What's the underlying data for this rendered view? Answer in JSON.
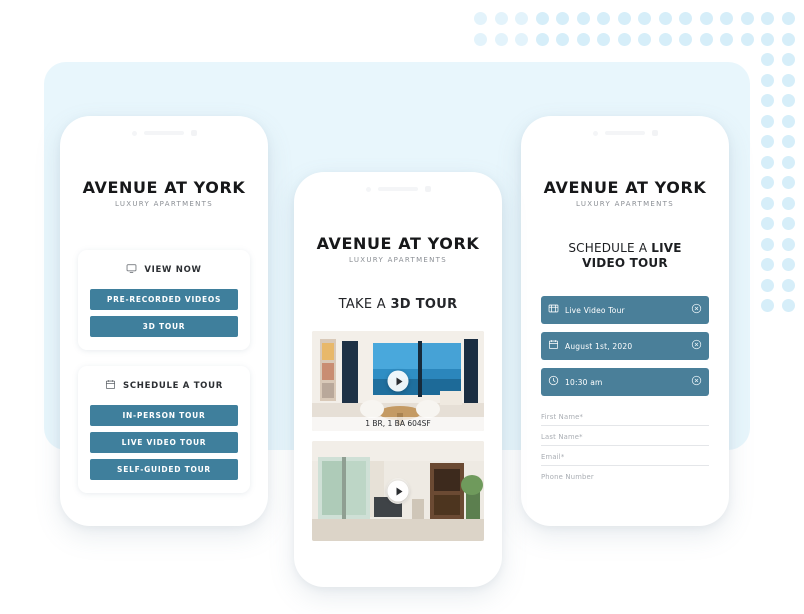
{
  "theme": {
    "accent": "#3f7f9c",
    "chip": "#4a7f99",
    "panel_bg": "#e8f6fc",
    "dot": "#d6eef9",
    "page_bg": "#ffffff"
  },
  "brand": {
    "title": "AVENUE AT YORK",
    "subtitle": "LUXURY APARTMENTS"
  },
  "phone1": {
    "name": "tour-options-screen",
    "view_now_card": {
      "icon": "monitor-icon",
      "title": "VIEW NOW",
      "buttons": [
        {
          "label": "PRE-RECORDED VIDEOS"
        },
        {
          "label": "3D TOUR"
        }
      ]
    },
    "schedule_card": {
      "icon": "calendar-icon",
      "title": "SCHEDULE A TOUR",
      "buttons": [
        {
          "label": "IN-PERSON TOUR"
        },
        {
          "label": "LIVE VIDEO TOUR"
        },
        {
          "label": "SELF-GUIDED TOUR"
        }
      ]
    }
  },
  "phone2": {
    "name": "3d-tour-screen",
    "heading_plain": "TAKE A ",
    "heading_bold": "3D TOUR",
    "media": [
      {
        "name": "unit-video-corner-window",
        "caption": "1 BR, 1 BA 604SF",
        "play_icon": "play-icon"
      },
      {
        "name": "living-room-video",
        "caption": "",
        "play_icon": "play-icon"
      }
    ]
  },
  "phone3": {
    "name": "schedule-live-video-tour-screen",
    "heading_line1_plain": "SCHEDULE A ",
    "heading_line1_bold": "LIVE",
    "heading_line2": "VIDEO TOUR",
    "chips": [
      {
        "icon": "video-tour-icon",
        "label": "Live Video Tour",
        "remove_icon": "close-circle-icon"
      },
      {
        "icon": "calendar-icon",
        "label": "August 1st, 2020",
        "remove_icon": "close-circle-icon"
      },
      {
        "icon": "clock-icon",
        "label": "10:30 am",
        "remove_icon": "close-circle-icon"
      }
    ],
    "fields": [
      {
        "placeholder": "First Name*"
      },
      {
        "placeholder": "Last Name*"
      },
      {
        "placeholder": "Email*"
      },
      {
        "placeholder": "Phone Number"
      }
    ]
  }
}
